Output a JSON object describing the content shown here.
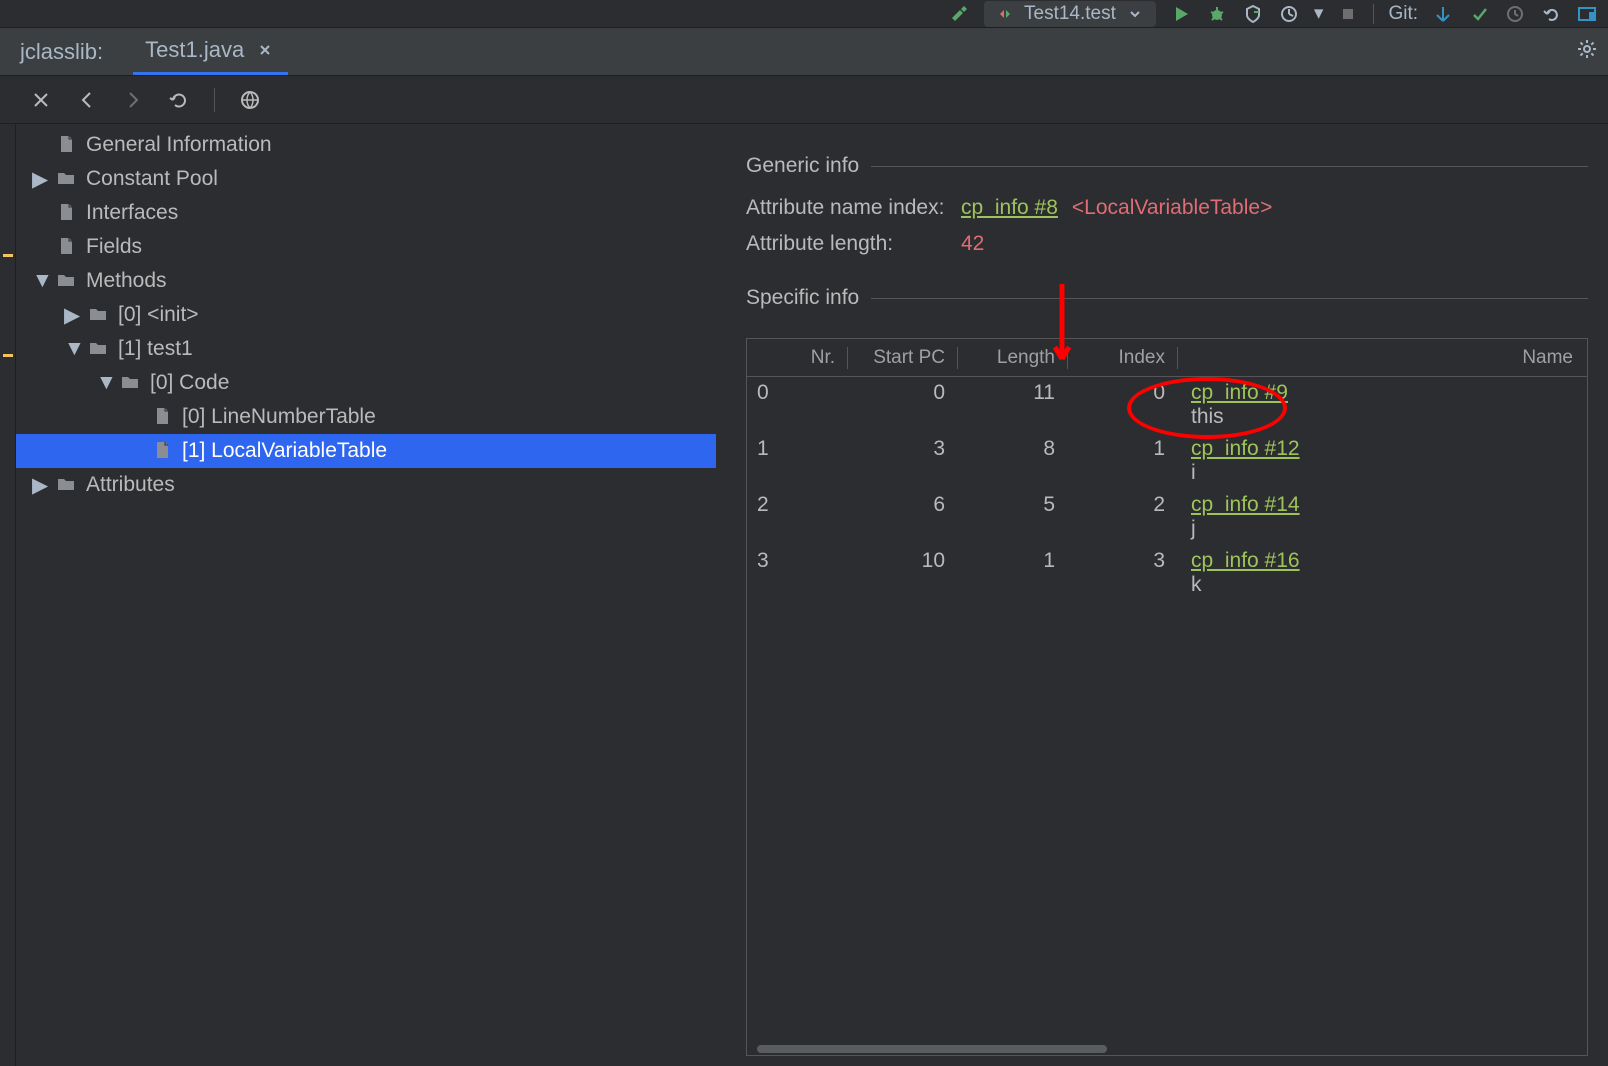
{
  "toolbar": {
    "run_config": "Test14.test",
    "git_label": "Git:"
  },
  "tabs": {
    "plugin": "jclasslib:",
    "file": "Test1.java"
  },
  "tree": [
    {
      "indent": 0,
      "tw": "",
      "icon": "file",
      "label": "General Information",
      "sel": false
    },
    {
      "indent": 0,
      "tw": "▶",
      "icon": "folder",
      "label": "Constant Pool",
      "sel": false
    },
    {
      "indent": 0,
      "tw": "",
      "icon": "file",
      "label": "Interfaces",
      "sel": false
    },
    {
      "indent": 0,
      "tw": "",
      "icon": "file",
      "label": "Fields",
      "sel": false
    },
    {
      "indent": 0,
      "tw": "▼",
      "icon": "folder",
      "label": "Methods",
      "sel": false
    },
    {
      "indent": 1,
      "tw": "▶",
      "icon": "folder",
      "label": "[0] <init>",
      "sel": false
    },
    {
      "indent": 1,
      "tw": "▼",
      "icon": "folder",
      "label": "[1] test1",
      "sel": false
    },
    {
      "indent": 2,
      "tw": "▼",
      "icon": "folder",
      "label": "[0] Code",
      "sel": false
    },
    {
      "indent": 3,
      "tw": "",
      "icon": "file",
      "label": "[0] LineNumberTable",
      "sel": false
    },
    {
      "indent": 3,
      "tw": "",
      "icon": "file",
      "label": "[1] LocalVariableTable",
      "sel": true
    },
    {
      "indent": 0,
      "tw": "▶",
      "icon": "folder",
      "label": "Attributes",
      "sel": false
    }
  ],
  "generic": {
    "title": "Generic info",
    "attr_name_label": "Attribute name index:",
    "attr_name_link": "cp_info #8",
    "attr_name_text": "<LocalVariableTable>",
    "attr_len_label": "Attribute length:",
    "attr_len_value": "42"
  },
  "specific": {
    "title": "Specific info",
    "columns": [
      "Nr.",
      "Start PC",
      "Length",
      "Index",
      "Name"
    ],
    "rows": [
      {
        "nr": "0",
        "start_pc": "0",
        "length": "11",
        "index": "0",
        "cp": "cp_info #9",
        "var": "this"
      },
      {
        "nr": "1",
        "start_pc": "3",
        "length": "8",
        "index": "1",
        "cp": "cp_info #12",
        "var": "i"
      },
      {
        "nr": "2",
        "start_pc": "6",
        "length": "5",
        "index": "2",
        "cp": "cp_info #14",
        "var": "j"
      },
      {
        "nr": "3",
        "start_pc": "10",
        "length": "1",
        "index": "3",
        "cp": "cp_info #16",
        "var": "k"
      }
    ]
  }
}
